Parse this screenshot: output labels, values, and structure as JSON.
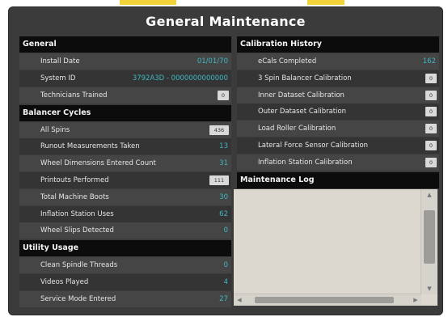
{
  "title": "General Maintenance",
  "colors": {
    "value_accent": "#3fb8c4",
    "header_bg": "#0c0c0c",
    "panel_bg": "#3b3b3b"
  },
  "general": {
    "header": "General",
    "install_date": {
      "label": "Install Date",
      "value": "01/01/70"
    },
    "system_id": {
      "label": "System ID",
      "value": "3792A3D - 0000000000000"
    },
    "technicians_trained": {
      "label": "Technicians Trained",
      "value": "0"
    }
  },
  "balancer_cycles": {
    "header": "Balancer Cycles",
    "all_spins": {
      "label": "All Spins",
      "value": "436"
    },
    "runout_measurements": {
      "label": "Runout Measurements Taken",
      "value": "13"
    },
    "wheel_dimensions": {
      "label": "Wheel Dimensions Entered Count",
      "value": "31"
    },
    "printouts": {
      "label": "Printouts Performed",
      "value": "111"
    },
    "machine_boots": {
      "label": "Total Machine Boots",
      "value": "30"
    },
    "inflation_station_uses": {
      "label": "Inflation Station Uses",
      "value": "62"
    },
    "wheel_slips": {
      "label": "Wheel Slips Detected",
      "value": "0"
    }
  },
  "utility_usage": {
    "header": "Utility Usage",
    "clean_spindle_threads": {
      "label": "Clean Spindle Threads",
      "value": "0"
    },
    "videos_played": {
      "label": "Videos Played",
      "value": "4"
    },
    "service_mode": {
      "label": "Service Mode Entered",
      "value": "27"
    }
  },
  "calibration_history": {
    "header": "Calibration History",
    "ecals_completed": {
      "label": "eCals Completed",
      "value": "162"
    },
    "spin_balancer": {
      "label": "3 Spin Balancer Calibration",
      "value": "0"
    },
    "inner_dataset": {
      "label": "Inner Dataset Calibration",
      "value": "0"
    },
    "outer_dataset": {
      "label": "Outer Dataset Calibration",
      "value": "0"
    },
    "load_roller": {
      "label": "Load Roller Calibration",
      "value": "0"
    },
    "lateral_force": {
      "label": "Lateral Force Sensor Calibration",
      "value": "0"
    },
    "inflation_station": {
      "label": "Inflation Station Calibration",
      "value": "0"
    }
  },
  "maintenance_log": {
    "header": "Maintenance Log",
    "icons": {
      "scroll_up": "arrow-up-icon",
      "scroll_down": "arrow-down-icon",
      "scroll_left": "arrow-left-icon",
      "scroll_right": "arrow-right-icon"
    }
  }
}
